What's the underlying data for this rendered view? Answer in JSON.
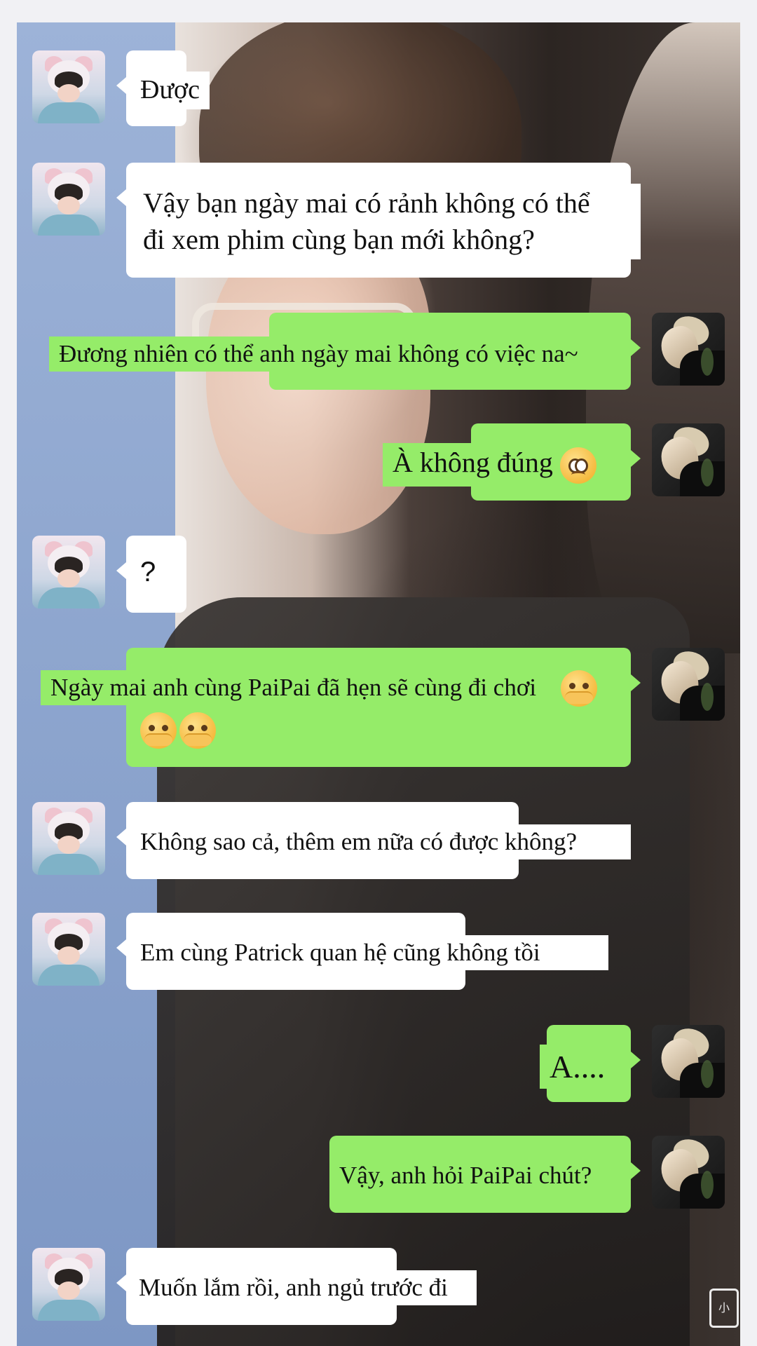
{
  "conversation": {
    "messages": [
      {
        "side": "left",
        "text": "Được"
      },
      {
        "side": "left",
        "line1": "Vậy bạn ngày mai có rảnh không có thể",
        "line2": "đi xem phim cùng bạn mới không?"
      },
      {
        "side": "right",
        "text": "Đương nhiên có thể anh ngày mai không có việc na~"
      },
      {
        "side": "right",
        "text": "À không đúng",
        "emoji": "pleading-face-icon"
      },
      {
        "side": "left",
        "text": "?"
      },
      {
        "side": "right",
        "text": "Ngày mai anh cùng PaiPai đã hẹn sẽ cùng đi chơi",
        "emoji": "face-with-hand-over-mouth-icon"
      },
      {
        "side": "left",
        "text": "Không sao cả, thêm em nữa có được không?"
      },
      {
        "side": "left",
        "text": "Em cùng Patrick quan hệ cũng không tồi"
      },
      {
        "side": "right",
        "text": "A...."
      },
      {
        "side": "right",
        "text": "Vậy, anh hỏi PaiPai chút?"
      },
      {
        "side": "left",
        "text": "Muốn lắm rồi, anh ngủ trước đi"
      }
    ]
  },
  "colors": {
    "incoming_bubble": "#ffffff",
    "outgoing_bubble": "#95ec69",
    "text": "#111111"
  },
  "avatars": {
    "left": "contact-avatar-icon",
    "right": "own-avatar-icon"
  },
  "watermark": {
    "text": "小"
  }
}
